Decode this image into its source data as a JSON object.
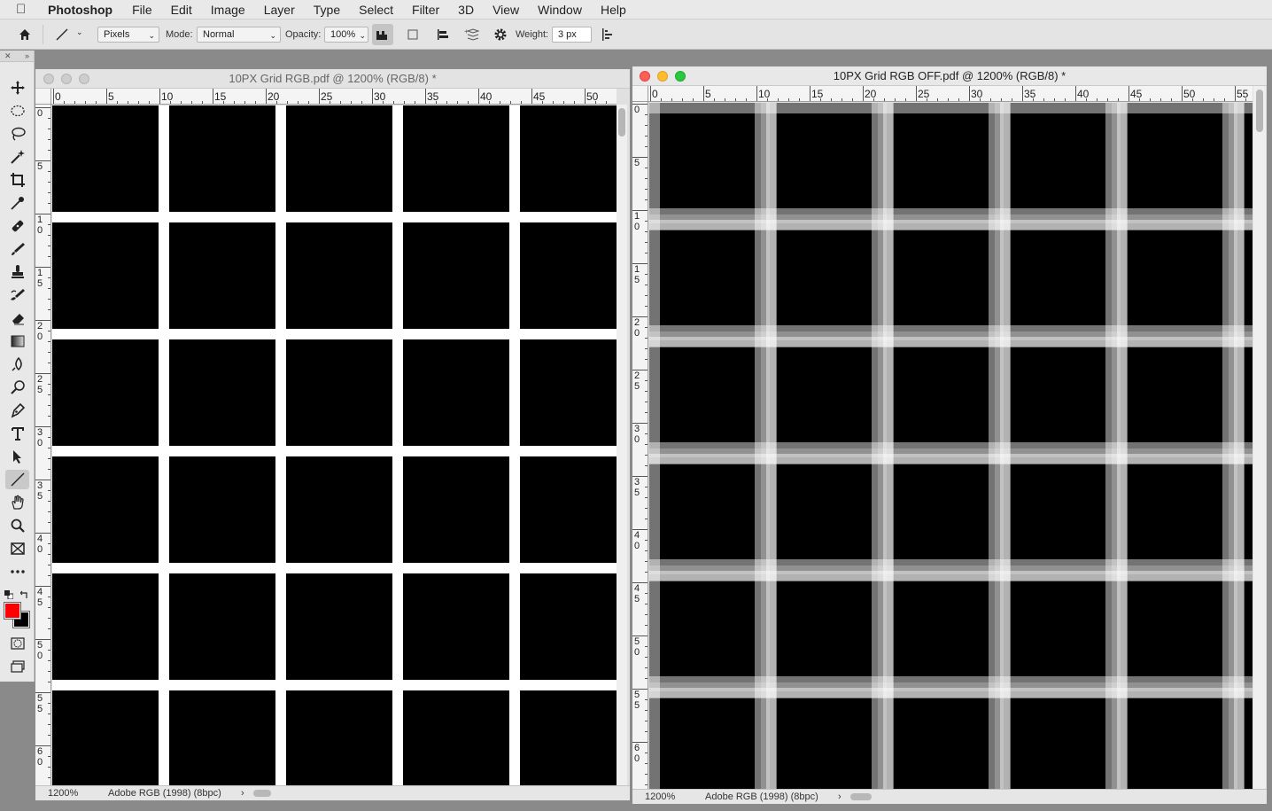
{
  "menubar": {
    "app_name": "Photoshop",
    "items": [
      "File",
      "Edit",
      "Image",
      "Layer",
      "Type",
      "Select",
      "Filter",
      "3D",
      "View",
      "Window",
      "Help"
    ]
  },
  "options": {
    "tool_mode": "Pixels",
    "mode_label": "Mode:",
    "mode_value": "Normal",
    "opacity_label": "Opacity:",
    "opacity_value": "100%",
    "weight_label": "Weight:",
    "weight_value": "3 px"
  },
  "tools": [
    "move-tool",
    "marquee-tool",
    "lasso-tool",
    "magic-wand-tool",
    "crop-tool",
    "eyedropper-tool",
    "healing-brush-tool",
    "brush-tool",
    "clone-stamp-tool",
    "history-brush-tool",
    "eraser-tool",
    "gradient-tool",
    "blur-tool",
    "dodge-tool",
    "pen-tool",
    "type-tool",
    "path-selection-tool",
    "line-tool",
    "hand-tool",
    "zoom-tool",
    "frame-tool",
    "more-tools"
  ],
  "colors": {
    "foreground": "#ff0000",
    "background": "#000000"
  },
  "doc_left": {
    "title": "10PX Grid RGB.pdf @ 1200% (RGB/8) *",
    "zoom": "1200%",
    "profile": "Adobe RGB (1998) (8bpc)",
    "ruler_h": [
      "0",
      "5",
      "10",
      "15",
      "20",
      "25",
      "30",
      "35",
      "40",
      "45",
      "50"
    ],
    "ruler_v": [
      "0",
      "5",
      "10",
      "15",
      "20",
      "25",
      "30",
      "35",
      "40",
      "45",
      "50",
      "55",
      "60"
    ]
  },
  "doc_right": {
    "title": "10PX Grid RGB OFF.pdf @ 1200% (RGB/8) *",
    "zoom": "1200%",
    "profile": "Adobe RGB (1998) (8bpc)",
    "ruler_h": [
      "0",
      "5",
      "10",
      "15",
      "20",
      "25",
      "30",
      "35",
      "40",
      "45",
      "50",
      "55"
    ],
    "ruler_v": [
      "0",
      "5",
      "10",
      "15",
      "20",
      "25",
      "30",
      "35",
      "40",
      "45",
      "50",
      "55",
      "60"
    ]
  }
}
